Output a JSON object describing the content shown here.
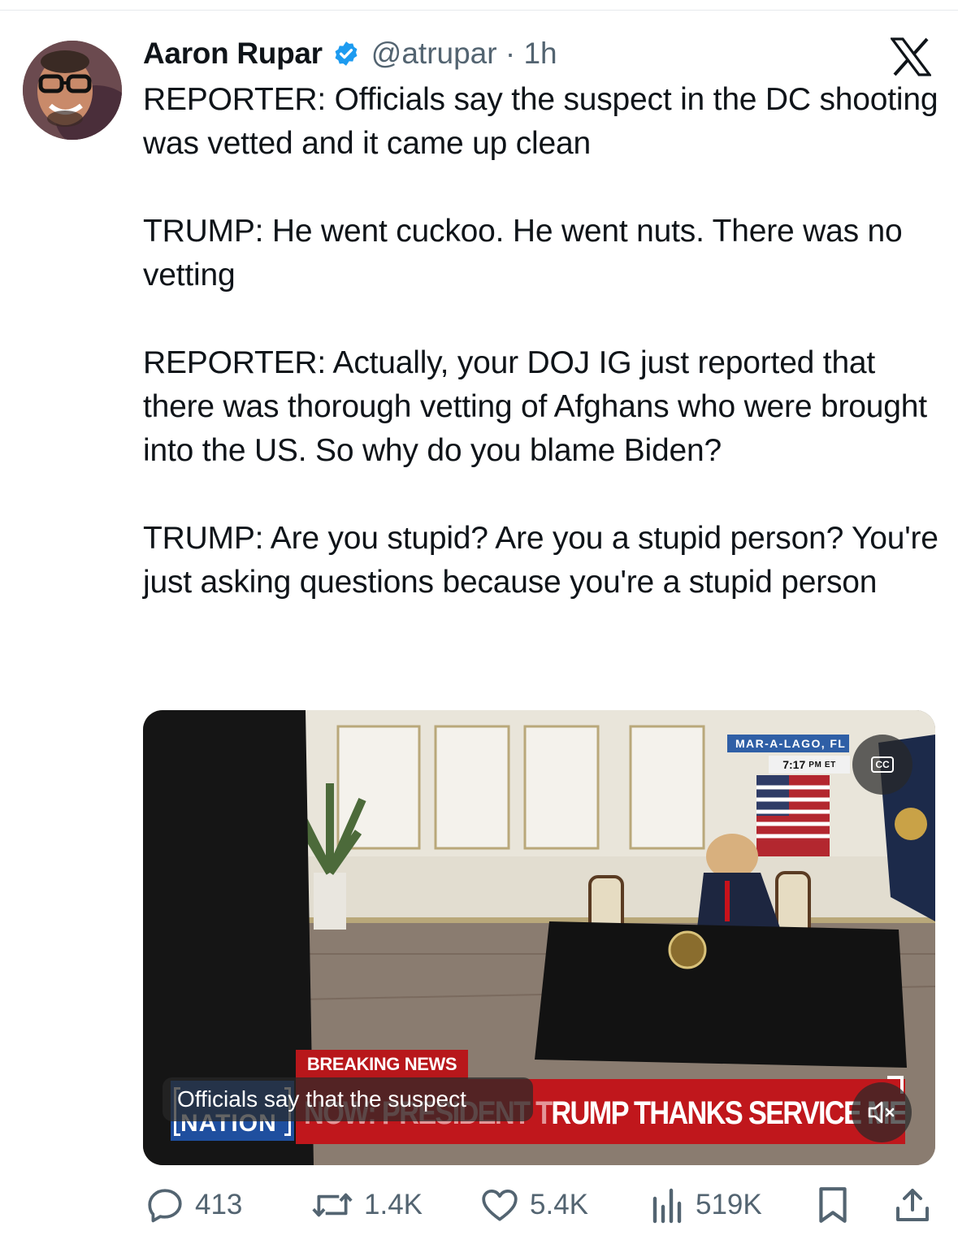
{
  "tweet": {
    "author": {
      "display_name": "Aaron Rupar",
      "handle": "@atrupar",
      "time_ago": "1h",
      "verified": true,
      "verified_color": "#1d9bf0"
    },
    "platform_icon": "x-logo-icon",
    "text": [
      "REPORTER: Officials say the suspect in the DC shooting was vetted and it came up clean",
      "TRUMP: He went cuckoo. He went nuts. There was no vetting",
      "REPORTER: Actually, your DOJ IG just reported that there was thorough vetting of Afghans who were brought into the US. So why do you blame Biden?",
      "TRUMP: Are you stupid? Are you a stupid person? You're just asking questions because you're a stupid person"
    ],
    "video": {
      "location": "MAR-A-LAGO, FL",
      "time": "7:17",
      "time_suffix": "PM ET",
      "cc_label": "CC",
      "breaking_label": "BREAKING NEWS",
      "ticker_prefix": "NOW: PRESIDENT T",
      "ticker_main": "RUMP THANKS SERVICE MEMBER",
      "network_logo_text": "NATION",
      "caption": "Officials say that the suspect",
      "mute_icon": "speaker-muted-icon"
    },
    "stats": {
      "replies": "413",
      "reposts": "1.4K",
      "likes": "5.4K",
      "views": "519K"
    }
  }
}
